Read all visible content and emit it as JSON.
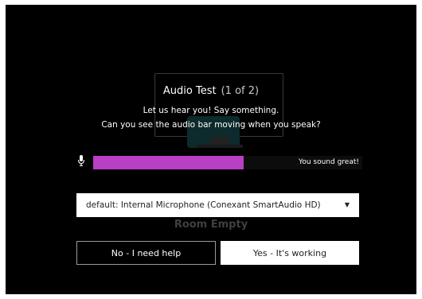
{
  "dialog": {
    "title": "Audio Test",
    "step": "(1 of 2)",
    "instruction_1": "Let us hear you! Say something.",
    "instruction_2": "Can you see the audio bar moving when you speak?"
  },
  "audio_level": {
    "level_fraction": 0.56,
    "fill_color": "#b93fc4",
    "status_text": "You sound great!",
    "icon": "microphone-icon"
  },
  "device_select": {
    "selected_value": "default: Internal Microphone (Conexant SmartAudio HD)",
    "arrow_glyph": "▼"
  },
  "buttons": {
    "no_label": "No - I need help",
    "yes_label": "Yes - It's working"
  },
  "background": {
    "room_status": "Room Empty"
  }
}
